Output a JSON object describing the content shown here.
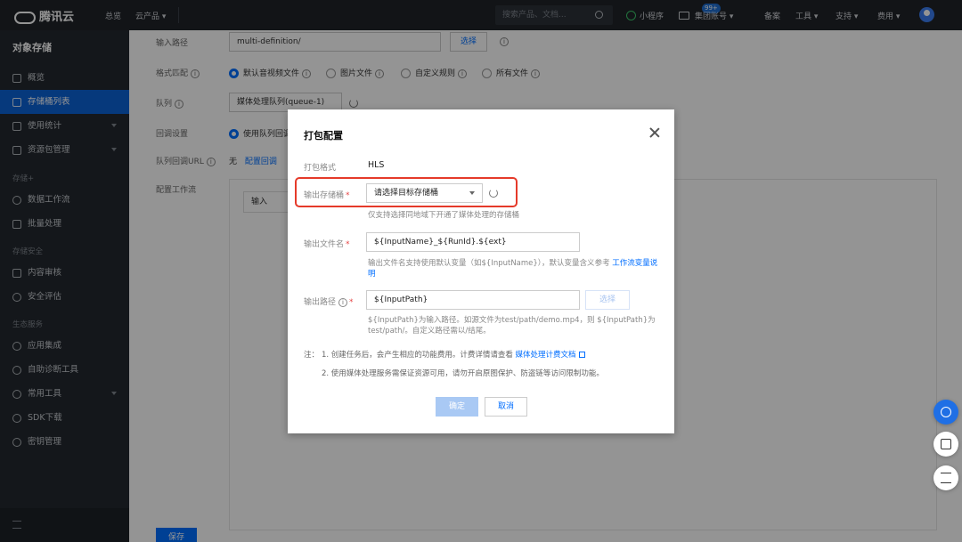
{
  "topbar": {
    "brand": "腾讯云",
    "nav": [
      "总览",
      "云产品 ▾"
    ],
    "search_placeholder": "搜索产品、文档...",
    "mini_program": "小程序",
    "badge": "99+",
    "account": "集团账号 ▾",
    "right": [
      "备案",
      "工具 ▾",
      "支持 ▾",
      "费用 ▾"
    ]
  },
  "sidebar": {
    "title": "对象存储",
    "items": [
      {
        "label": "概览"
      },
      {
        "label": "存储桶列表"
      },
      {
        "label": "使用统计"
      },
      {
        "label": "资源包管理"
      }
    ],
    "group1": "存储+",
    "items2": [
      {
        "label": "数据工作流"
      },
      {
        "label": "批量处理"
      }
    ],
    "group2": "存储安全",
    "items3": [
      {
        "label": "内容审核"
      },
      {
        "label": "安全评估"
      }
    ],
    "group3": "生态服务",
    "items4": [
      {
        "label": "应用集成"
      },
      {
        "label": "自助诊断工具"
      },
      {
        "label": "常用工具"
      },
      {
        "label": "SDK下载"
      },
      {
        "label": "密钥管理"
      }
    ]
  },
  "main": {
    "input_path_label": "输入路径",
    "input_path_value": "multi-definition/",
    "select_btn": "选择",
    "format_label": "格式匹配",
    "format_opts": [
      "默认音视频文件",
      "图片文件",
      "自定义规则",
      "所有文件"
    ],
    "queue_label": "队列",
    "queue_value": "媒体处理队列(queue-1)",
    "callback_label": "回调设置",
    "callback_value": "使用队列回调",
    "queue_cb_label": "队列回调URL",
    "queue_cb_value": "无",
    "queue_cb_link": "配置回调",
    "workflow_label": "配置工作流",
    "workflow_input": "输入",
    "save": "保存"
  },
  "modal": {
    "title": "打包配置",
    "format_label": "打包格式",
    "format_value": "HLS",
    "bucket_label": "输出存储桶",
    "bucket_placeholder": "请选择目标存储桶",
    "bucket_hint": "仅支持选择同地域下开通了媒体处理的存储桶",
    "filename_label": "输出文件名",
    "filename_value": "${InputName}_${RunId}.${ext}",
    "filename_hint": "输出文件名支持使用默认变量（如${InputName}），默认变量含义参考",
    "filename_link": "工作流变量说明",
    "path_label": "输出路径",
    "path_value": "${InputPath}",
    "path_select": "选择",
    "path_hint": "${InputPath}为输入路径。如源文件为test/path/demo.mp4，则 ${InputPath}为test/path/。自定义路径需以/结尾。",
    "note_prefix": "注：",
    "note1": "1. 创建任务后，会产生相应的功能费用。计费详情请查看",
    "note1_link": "媒体处理计费文档",
    "note2": "2. 使用媒体处理服务需保证资源可用，请勿开启原图保护、防盗链等访问限制功能。",
    "ok": "确定",
    "cancel": "取消"
  }
}
